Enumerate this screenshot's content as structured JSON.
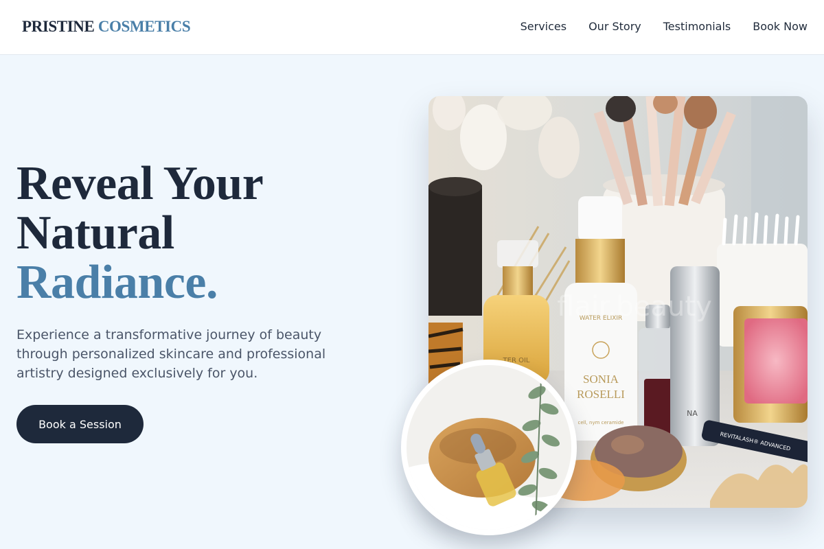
{
  "brand": {
    "name_dark": "PRISTINE",
    "name_accent": "COSMETICS"
  },
  "nav": {
    "items": [
      {
        "label": "Services"
      },
      {
        "label": "Our Story"
      },
      {
        "label": "Testimonials"
      },
      {
        "label": "Book Now"
      }
    ]
  },
  "hero": {
    "title_line1": "Reveal Your",
    "title_line2": "Natural",
    "title_accent": "Radiance.",
    "subtitle": "Experience a transformative journey of beauty through personalized skincare and professional artistry designed exclusively for you.",
    "cta_label": "Book a Session"
  },
  "images": {
    "main_watermark": "flair.beauty",
    "serum_label_line1": "SONIA",
    "serum_label_line2": "ROSELLI",
    "serum_top_label": "WATER ELIXIR",
    "serum_bottom_text": "cell, nym ceramide",
    "lash_label": "REVITALASH® ADVANCED",
    "cylinder_label": "NA"
  },
  "colors": {
    "primary_dark": "#1e293b",
    "accent_blue": "#4a7fa8",
    "page_bg": "#f0f7fd",
    "header_bg": "#ffffff",
    "body_text": "#4a5568"
  }
}
